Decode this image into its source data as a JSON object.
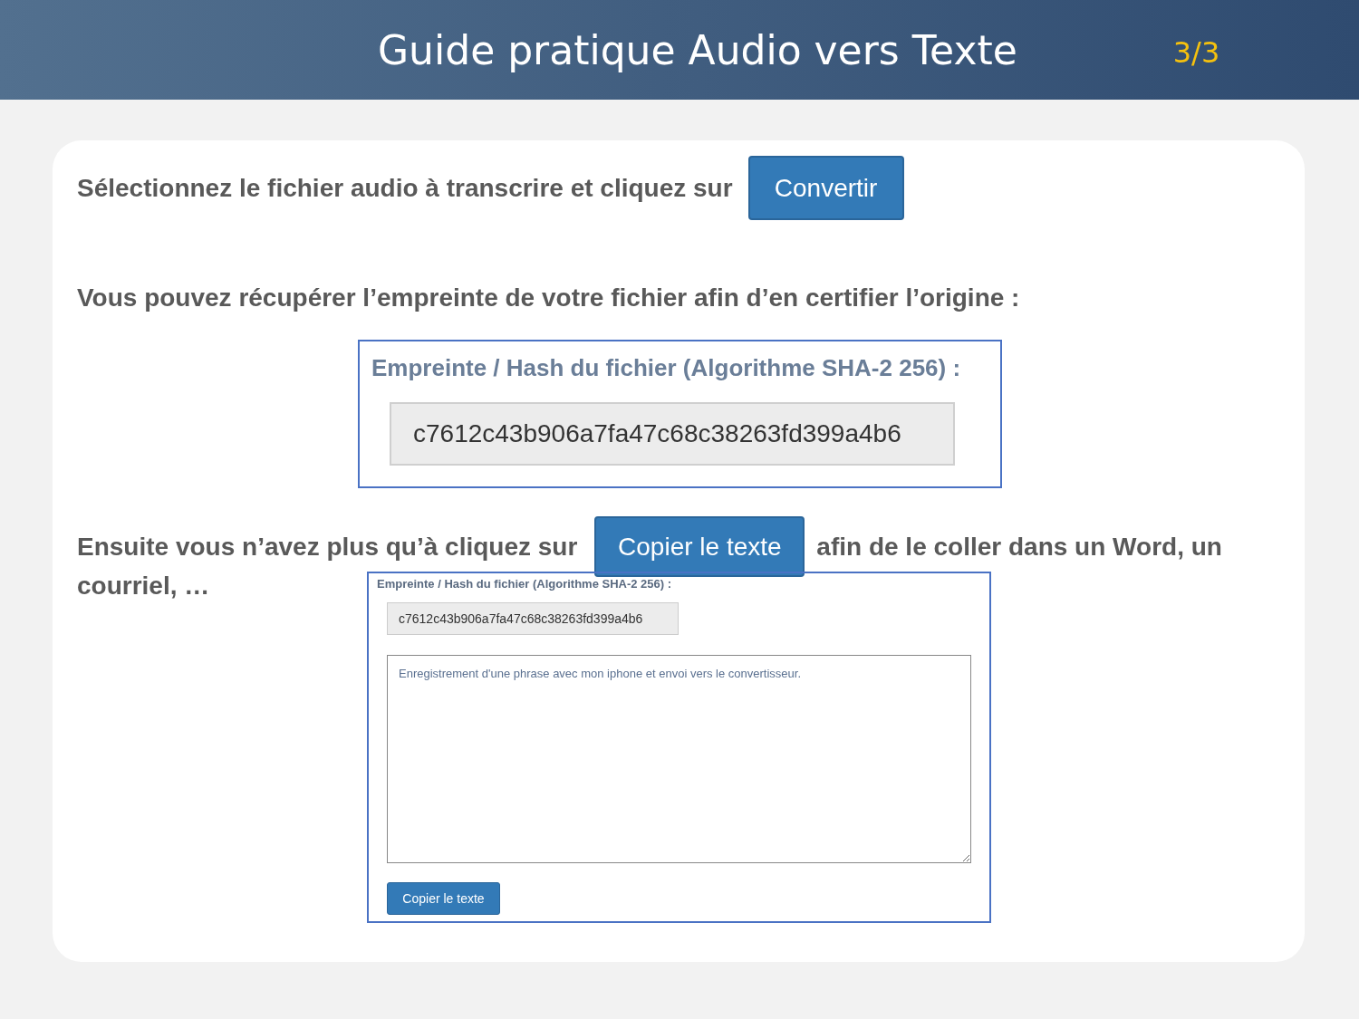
{
  "header": {
    "title": "Guide pratique Audio vers Texte",
    "page": "3/3"
  },
  "step1": {
    "text": "Sélectionnez le fichier audio à transcrire et cliquez sur",
    "button": "Convertir"
  },
  "step2": {
    "text": "Vous pouvez récupérer l’empreinte de votre fichier afin d’en certifier l’origine :"
  },
  "hash_panel": {
    "label": "Empreinte / Hash du fichier (Algorithme SHA-2 256) :",
    "value": "c7612c43b906a7fa47c68c38263fd399a4b6"
  },
  "step3": {
    "text_before": "Ensuite vous n’avez plus qu’à cliquez sur",
    "button": "Copier le texte",
    "text_after": "afin de le coller dans un Word, un",
    "text_after_line2": "courriel, …"
  },
  "result_panel": {
    "label": "Empreinte / Hash du fichier (Algorithme SHA-2 256) :",
    "hash_value": "c7612c43b906a7fa47c68c38263fd399a4b6",
    "transcript": "Enregistrement d'une phrase avec mon iphone et envoi vers le convertisseur.",
    "button": "Copier le texte"
  }
}
